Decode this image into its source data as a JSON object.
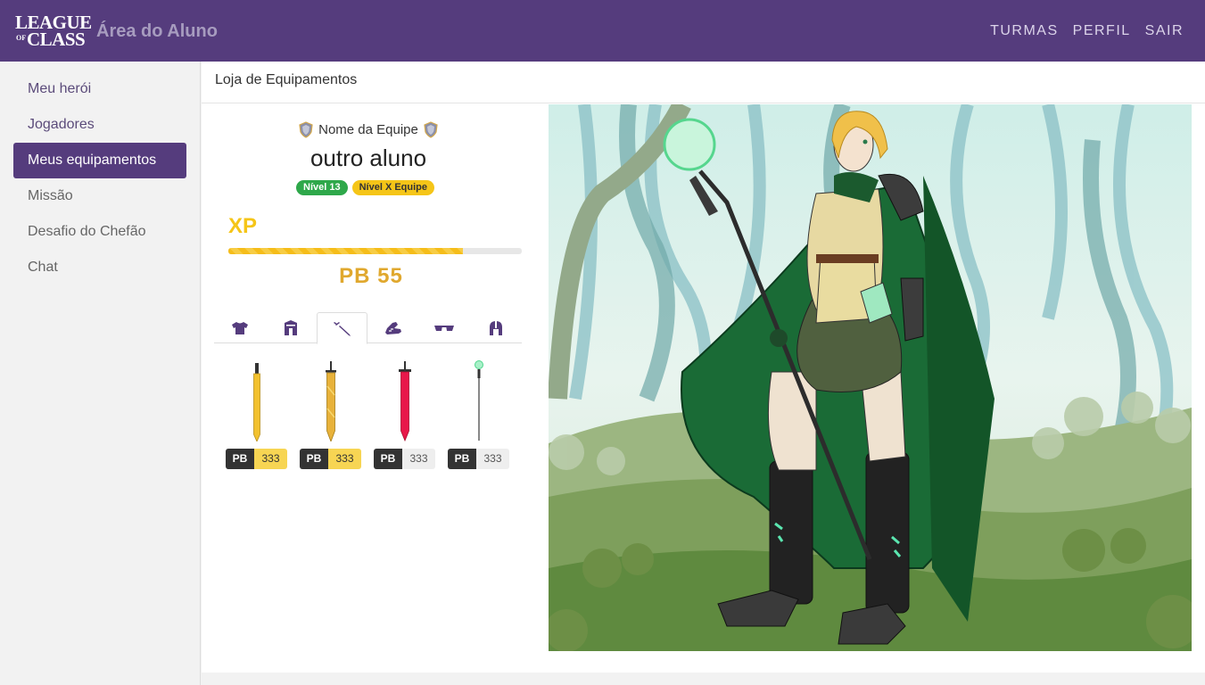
{
  "brand": {
    "logo_line1": "LEAGUE",
    "logo_line2_small": "OF",
    "logo_line2": "CLASS",
    "app_title": "Área do Aluno"
  },
  "topnav": [
    "TURMAS",
    "PERFIL",
    "SAIR"
  ],
  "sidebar": {
    "items": [
      {
        "label": "Meu herói",
        "state": "link"
      },
      {
        "label": "Jogadores",
        "state": "link"
      },
      {
        "label": "Meus equipamentos",
        "state": "active"
      },
      {
        "label": "Missão",
        "state": "inactive"
      },
      {
        "label": "Desafio do Chefão",
        "state": "inactive"
      },
      {
        "label": "Chat",
        "state": "inactive"
      }
    ]
  },
  "page": {
    "title": "Loja de Equipamentos"
  },
  "profile": {
    "team_name": "Nome da Equipe",
    "player_name": "outro aluno",
    "level_badge": "Nível 13",
    "team_level_badge": "Nível X Equipe",
    "xp_label": "XP",
    "xp_progress": 0.8,
    "pb_label": "PB",
    "pb_value": "55"
  },
  "equipment_tabs": [
    {
      "icon": "shirt-icon",
      "active": false
    },
    {
      "icon": "pants-icon",
      "active": false
    },
    {
      "icon": "sword-icon",
      "active": true
    },
    {
      "icon": "shoe-icon",
      "active": false
    },
    {
      "icon": "glasses-icon",
      "active": false
    },
    {
      "icon": "helmet-icon",
      "active": false
    }
  ],
  "items": [
    {
      "icon": "yellow-sword-icon",
      "price_label": "PB",
      "price": "333",
      "highlight": true
    },
    {
      "icon": "gold-sword-icon",
      "price_label": "PB",
      "price": "333",
      "highlight": true
    },
    {
      "icon": "red-sword-icon",
      "price_label": "PB",
      "price": "333",
      "highlight": false
    },
    {
      "icon": "staff-icon",
      "price_label": "PB",
      "price": "333",
      "highlight": false
    }
  ],
  "colors": {
    "brand_purple": "#553c7d",
    "xp_yellow": "#f5c518",
    "pb_gold": "#e0a82e",
    "level_green": "#2ea84a"
  }
}
